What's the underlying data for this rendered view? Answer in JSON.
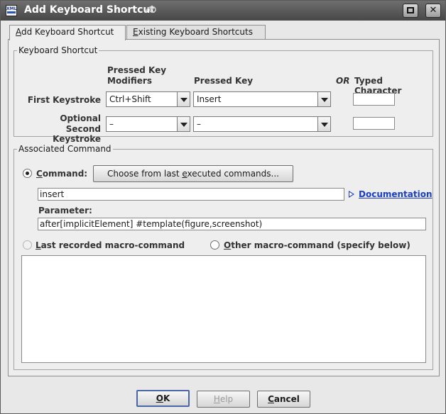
{
  "window": {
    "title": "Add Keyboard Shortcut",
    "app_icon_label": "XML"
  },
  "tabs": [
    {
      "label_prefix": "",
      "label_mnemonic": "A",
      "label_rest": "dd Keyboard Shortcut",
      "selected": true
    },
    {
      "label_prefix": "",
      "label_mnemonic": "E",
      "label_rest": "xisting Keyboard Shortcuts",
      "selected": false
    }
  ],
  "shortcut_group": {
    "title": "Keyboard Shortcut",
    "col_modifiers": "Pressed Key\nModifiers",
    "col_modifiers_l1": "Pressed Key",
    "col_modifiers_l2": "Modifiers",
    "col_key": "Pressed Key",
    "col_or": "OR",
    "col_typed": "Typed Character",
    "first_label": "First Keystroke",
    "first_modifiers": "Ctrl+Shift",
    "first_key": "Insert",
    "first_typed": "",
    "second_label_l1": "Optional",
    "second_label_l2": "Second Keystroke",
    "second_modifiers": "–",
    "second_key": "–",
    "second_typed": ""
  },
  "command_group": {
    "title": "Associated Command",
    "command_radio_prefix": "",
    "command_mnemonic": "C",
    "command_rest": "ommand:",
    "choose_button_pre": "Choose from last ",
    "choose_button_mnemonic": "e",
    "choose_button_post": "xecuted commands...",
    "command_value": "insert",
    "documentation_link": "Documentation",
    "parameter_label": "Parameter:",
    "parameter_value": "after[implicitElement] #template(figure,screenshot)",
    "last_macro_mnemonic": "L",
    "last_macro_rest": "ast recorded macro-command",
    "other_macro_pre": "O",
    "other_macro_rest": "ther macro-command (specify below)",
    "macro_text": ""
  },
  "buttons": {
    "ok_mnemonic": "O",
    "ok_rest": "K",
    "help_mnemonic": "H",
    "help_rest": "elp",
    "cancel_mnemonic": "C",
    "cancel_rest": "ancel"
  },
  "colors": {
    "titlebar": "#5a5a5a",
    "link": "#1b3ec5",
    "default_button_border": "#4b66a6"
  }
}
